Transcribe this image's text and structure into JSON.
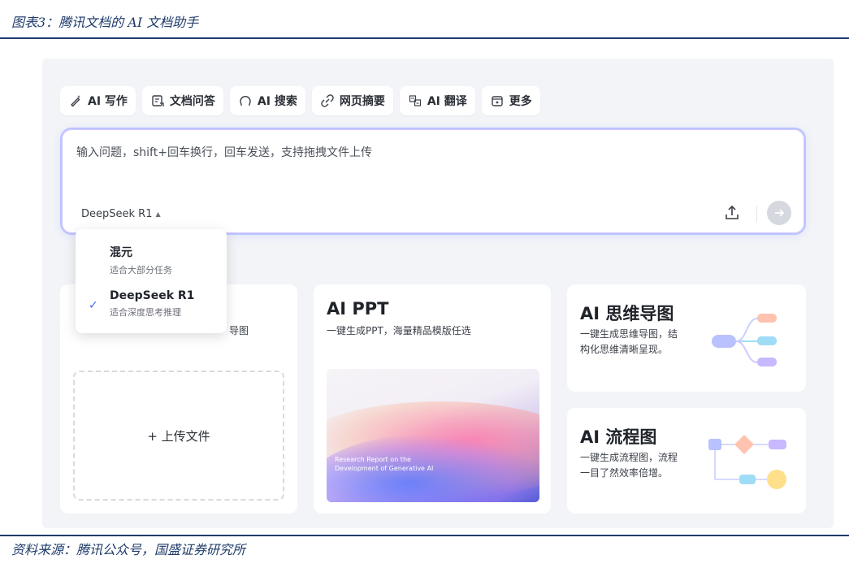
{
  "figure": {
    "caption": "图表3：腾讯文档的 AI 文档助手",
    "source": "资料来源：腾讯公众号，国盛证券研究所"
  },
  "toolbar": {
    "items": [
      {
        "label": "AI 写作",
        "icon": "pen-sparkle-icon"
      },
      {
        "label": "文档问答",
        "icon": "doc-chat-icon"
      },
      {
        "label": "AI 搜索",
        "icon": "search-icon"
      },
      {
        "label": "网页摘要",
        "icon": "link-icon"
      },
      {
        "label": "AI 翻译",
        "icon": "translate-icon"
      },
      {
        "label": "更多",
        "icon": "more-box-icon"
      }
    ]
  },
  "input": {
    "placeholder": "输入问题，shift+回车换行，回车发送，支持拖拽文件上传",
    "model": "DeepSeek R1"
  },
  "dropdown": {
    "options": [
      {
        "name": "混元",
        "desc": "适合大部分任务",
        "selected": false
      },
      {
        "name": "DeepSeek R1",
        "desc": "适合深度思考推理",
        "selected": true
      }
    ]
  },
  "cards": {
    "upload": {
      "partial_text": "导图",
      "label": "+ 上传文件"
    },
    "ppt": {
      "title": "AI PPT",
      "desc": "一键生成PPT，海量精品模版任选",
      "preview_lines": [
        "Research Report on the",
        "Development of Generative AI"
      ]
    },
    "mind": {
      "title": "AI 思维导图",
      "desc_lines": [
        "一键生成思维导图，结",
        "构化思维清晰呈现。"
      ]
    },
    "flow": {
      "title": "AI 流程图",
      "desc_lines": [
        "一键生成流程图，流程",
        "一目了然效率倍增。"
      ]
    }
  },
  "colors": {
    "accent": "#3b6cf6",
    "caption": "#1f3b6b",
    "border_glow": "#b9c4ff"
  }
}
